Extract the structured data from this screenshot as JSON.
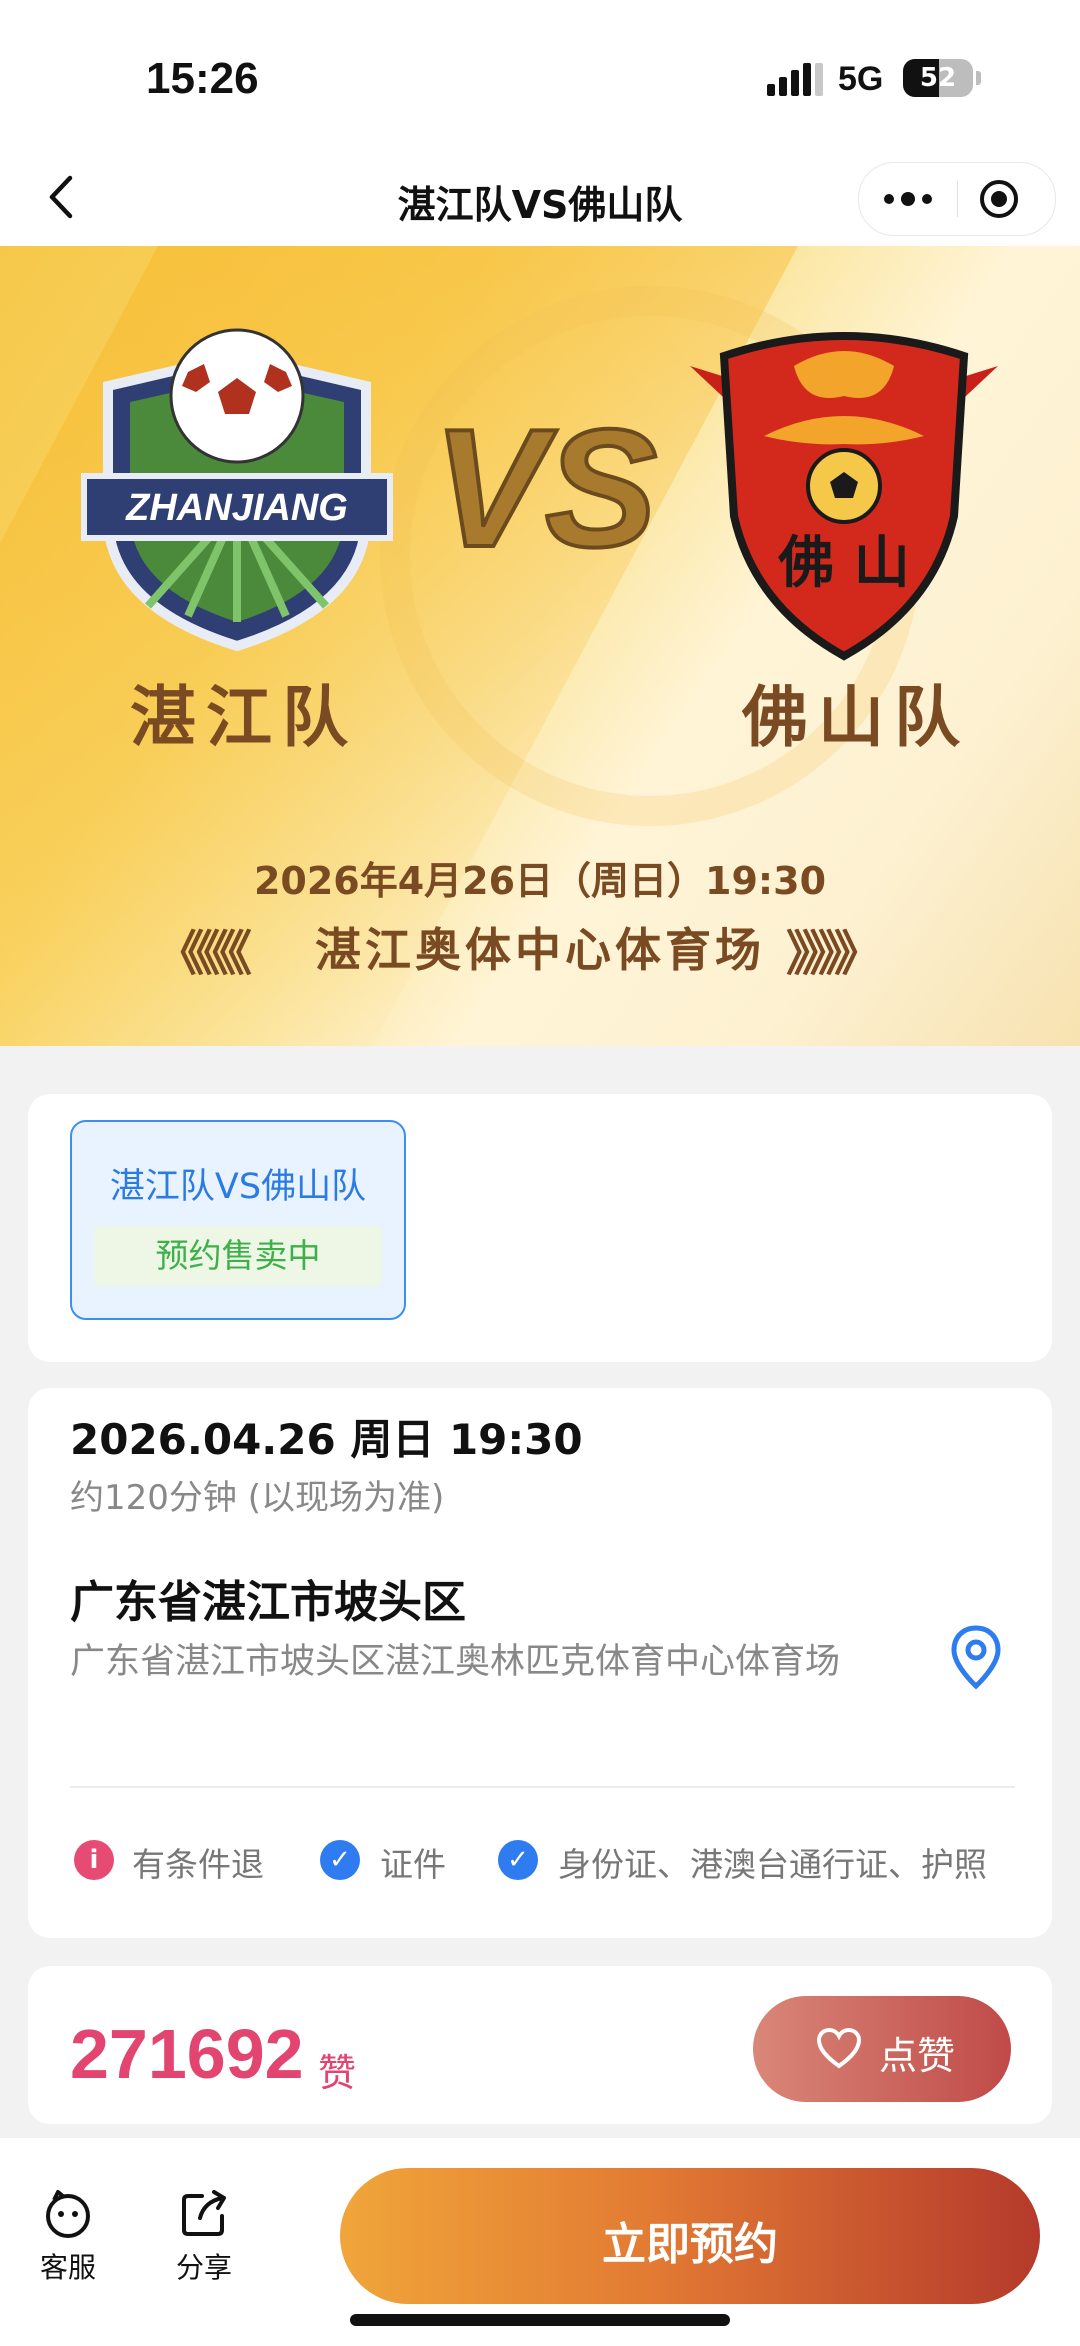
{
  "status_bar": {
    "time": "15:26",
    "network": "5G",
    "battery": "52",
    "battery_level": 0.52
  },
  "nav": {
    "title": "湛江队VS佛山队",
    "back_icon": "chevron-left-icon",
    "more_icon": "more-dots-icon",
    "close_icon": "target-icon"
  },
  "banner": {
    "home_badge_text": "ZHANJIANG",
    "vs": "VS",
    "away_badge_text": "佛 山",
    "home_team": "湛江队",
    "away_team": "佛山队",
    "datetime": "2026年4月26日（周日）19:30",
    "venue": "湛江奥体中心体育场",
    "chevrons_left": "《《《《",
    "chevrons_right": "》》》》"
  },
  "session": {
    "name": "湛江队VS佛山队",
    "status": "预约售卖中"
  },
  "info": {
    "datetime": "2026.04.26 周日 19:30",
    "duration": "约120分钟 (以现场为准)",
    "city": "广东省湛江市坡头区",
    "address": "广东省湛江市坡头区湛江奥林匹克体育中心体育场",
    "tags": [
      {
        "icon": "info-icon",
        "text": "有条件退"
      },
      {
        "icon": "check-icon",
        "text": "证件"
      },
      {
        "icon": "check-icon",
        "text": "身份证、港澳台通行证、护照"
      }
    ],
    "map_icon": "location-pin-icon"
  },
  "likes": {
    "count": "271692",
    "unit": "赞",
    "button_label": "点赞"
  },
  "bottom": {
    "service_label": "客服",
    "share_label": "分享",
    "cta_label": "立即预约"
  },
  "colors": {
    "accent": "#2a7be4",
    "likes": "#e2456f",
    "cta_start": "#f0a53a",
    "cta_end": "#b53a2c"
  }
}
